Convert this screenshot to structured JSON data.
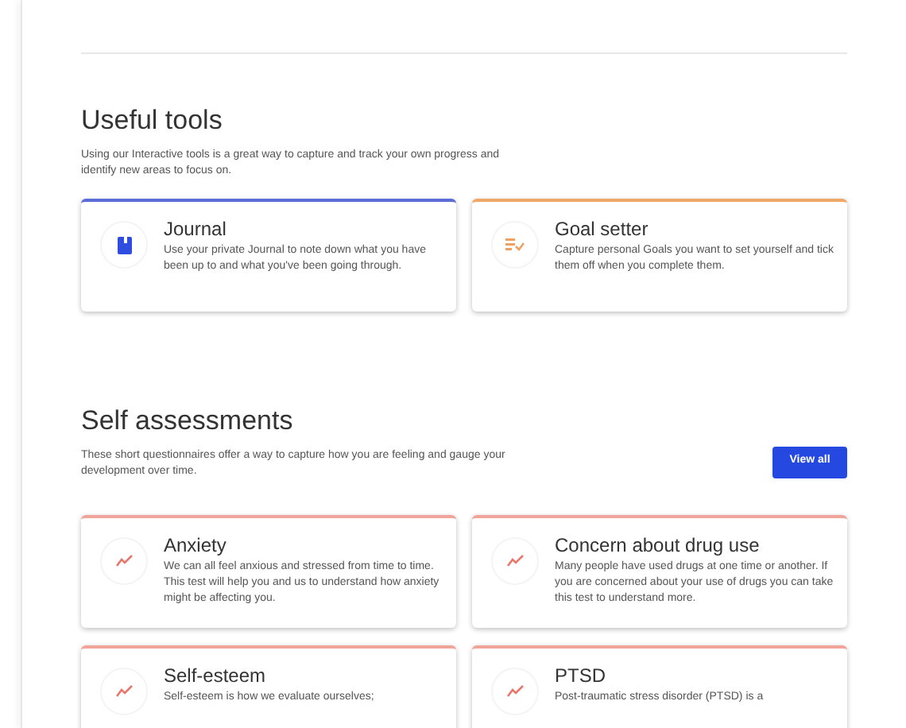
{
  "tools": {
    "title": "Useful tools",
    "description": "Using our Interactive tools is a great way to capture and track your own progress and identify new areas to focus on.",
    "cards": [
      {
        "kind": "journal",
        "color": "#5b6bd8",
        "title": "Journal",
        "text": "Use your private Journal to note down what you have been up to and what you've been going through."
      },
      {
        "kind": "goal",
        "color": "#f0a868",
        "title": "Goal setter",
        "text": "Capture personal Goals you want to set yourself and tick them off when you complete them."
      }
    ]
  },
  "assessments": {
    "title": "Self assessments",
    "description": "These short questionnaires offer a way to capture how you are feeling and gauge your development over time.",
    "button": "View all",
    "cards": [
      {
        "kind": "trend",
        "color": "#f0a49a",
        "title": "Anxiety",
        "text": "We can all feel anxious and stressed from time to time. This test will help you and us to understand how anxiety might be affecting you."
      },
      {
        "kind": "trend",
        "color": "#f0a49a",
        "title": "Concern about drug use",
        "text": "Many people have used drugs at one time or another. If you are concerned about your use of drugs you can take this test to understand more."
      },
      {
        "kind": "trend",
        "color": "#f0a49a",
        "title": "Self-esteem",
        "text": "Self-esteem is how we evaluate ourselves;"
      },
      {
        "kind": "trend",
        "color": "#f0a49a",
        "title": "PTSD",
        "text": "Post-traumatic stress disorder (PTSD) is a"
      }
    ]
  }
}
